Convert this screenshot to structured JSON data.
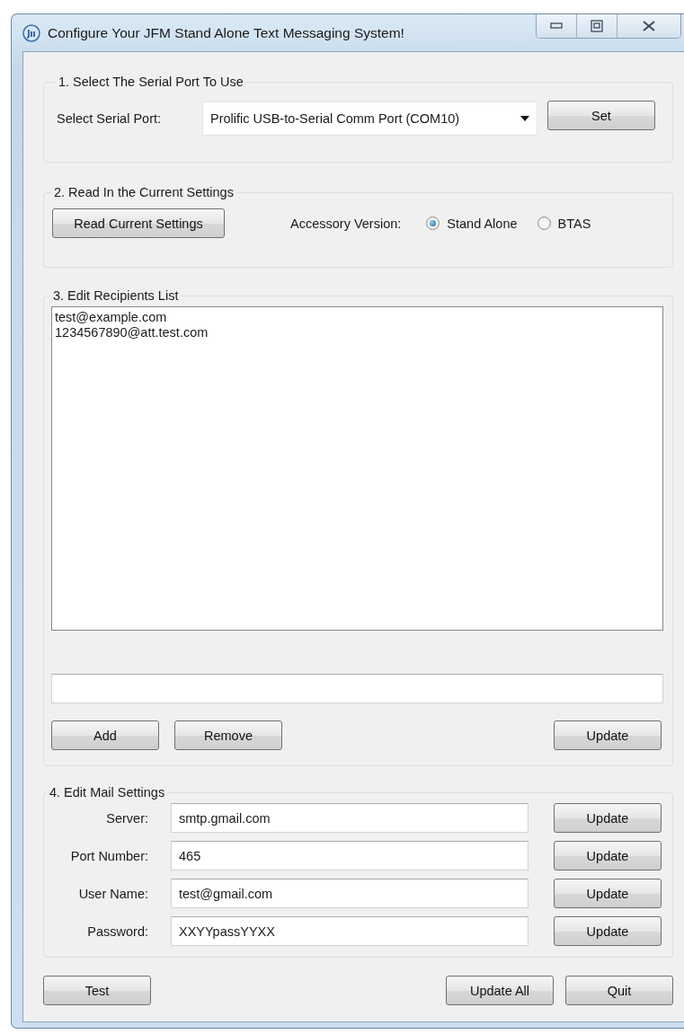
{
  "window": {
    "title": "Configure Your JFM Stand Alone Text Messaging System!"
  },
  "serial_port": {
    "legend": "1. Select The Serial Port To Use",
    "label": "Select Serial Port:",
    "value": "Prolific USB-to-Serial Comm Port (COM10)",
    "button": "Set"
  },
  "read_settings": {
    "legend": "2. Read In the Current Settings",
    "button": "Read Current Settings",
    "version_label": "Accessory Version:",
    "options": [
      {
        "label": "Stand Alone",
        "selected": true
      },
      {
        "label": "BTAS",
        "selected": false
      }
    ]
  },
  "recipients": {
    "legend": "3. Edit Recipients List",
    "items": [
      "test@example.com",
      "1234567890@att.test.com"
    ],
    "buttons": [
      "Add",
      "Remove",
      "Update"
    ]
  },
  "mail_settings": {
    "legend": "4.  Edit Mail Settings",
    "fields": [
      {
        "label": "Server:",
        "value": "smtp.gmail.com",
        "button": "Update"
      },
      {
        "label": "Port Number:",
        "value": "465",
        "button": "Update"
      },
      {
        "label": "User Name:",
        "value": "test@gmail.com",
        "button": "Update"
      },
      {
        "label": "Password:",
        "value": "XXYYpassYYXX",
        "button": "Update"
      }
    ]
  },
  "footer_buttons": [
    "Test",
    "Update All",
    "Quit"
  ]
}
